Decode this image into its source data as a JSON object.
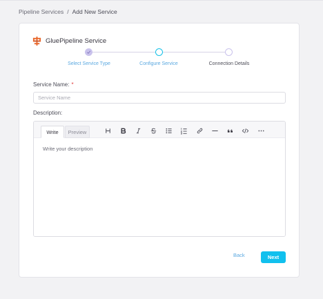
{
  "breadcrumb": {
    "items": [
      {
        "label": "Pipeline Services"
      },
      {
        "label": "Add New Service"
      }
    ],
    "separator": "/"
  },
  "service": {
    "title": "GluePipeline Service",
    "logo_icon": "glue-pipeline-logo-icon"
  },
  "stepper": {
    "steps": [
      {
        "label": "Select Service Type",
        "state": "completed"
      },
      {
        "label": "Configure Service",
        "state": "active"
      },
      {
        "label": "Connection Details",
        "state": "pending"
      }
    ]
  },
  "form": {
    "service_name": {
      "label": "Service Name:",
      "required_marker": "*",
      "value": "",
      "placeholder": "Service Name"
    },
    "description": {
      "label": "Description:",
      "tabs": [
        {
          "label": "Write",
          "selected": true
        },
        {
          "label": "Preview",
          "selected": false
        }
      ],
      "toolbar_icons": [
        "heading-icon",
        "bold-icon",
        "italic-icon",
        "strikethrough-icon",
        "bullet-list-icon",
        "numbered-list-icon",
        "link-icon",
        "horizontal-rule-icon",
        "quote-icon",
        "code-icon",
        "more-icon"
      ],
      "value": "",
      "placeholder": "Write your description"
    }
  },
  "actions": {
    "back_label": "Back",
    "next_label": "Next"
  },
  "colors": {
    "accent": "#11c0ee",
    "step_completed": "#c9c2ec",
    "step_active_border": "#13c0e8",
    "step_pending_border": "#c9c2ec",
    "link": "#5aa8e0",
    "required": "#e03b3b"
  }
}
